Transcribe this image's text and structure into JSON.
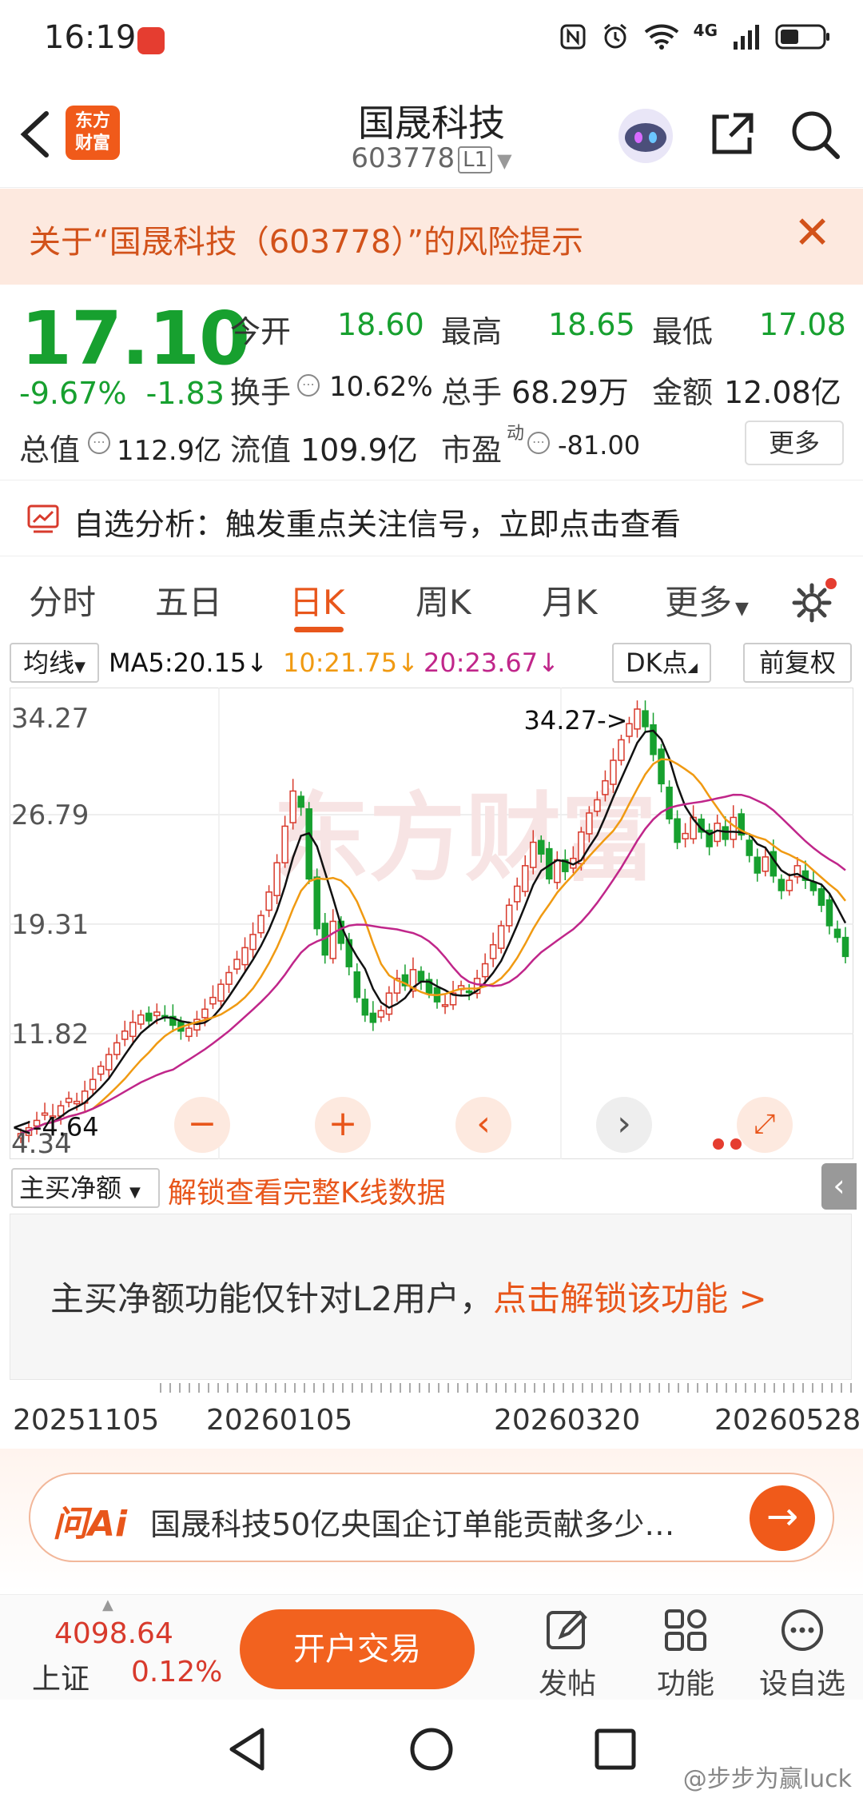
{
  "status_bar": {
    "time": "16:19",
    "network": "4G"
  },
  "header": {
    "logo_text_line1": "东方",
    "logo_text_line2": "财富",
    "title": "国晟科技",
    "code": "603778",
    "level": "L1"
  },
  "risk_banner": {
    "text": "关于“国晟科技（603778）”的风险提示"
  },
  "quote": {
    "price": "17.10",
    "change_pct": "-9.67%",
    "change": "-1.83",
    "open_label": "今开",
    "open": "18.60",
    "high_label": "最高",
    "high": "18.65",
    "low_label": "最低",
    "low": "17.08",
    "turnover_label": "换手",
    "turnover": "10.62%",
    "volume_label": "总手",
    "volume": "68.29万",
    "amount_label": "金额",
    "amount": "12.08亿",
    "mktcap_label": "总值",
    "mktcap": "112.9亿",
    "float_label": "流值",
    "float": "109.9亿",
    "pe_label": "市盈",
    "pe_sup": "动",
    "pe": "-81.00",
    "more": "更多"
  },
  "analysis": {
    "text": "自选分析：触发重点关注信号，立即点击查看"
  },
  "tabs": [
    "分时",
    "五日",
    "日K",
    "周K",
    "月K",
    "更多"
  ],
  "ma_row": {
    "type": "均线",
    "ma5": "MA5:20.15↓",
    "ma10": "10:21.75↓",
    "ma20": "20:23.67↓",
    "dk": "DK点",
    "adjust": "前复权"
  },
  "colors": {
    "accent": "#e8561b",
    "up": "#d83a2c",
    "down": "#17a02f",
    "ma5": "#111111",
    "ma10": "#f09a12",
    "ma20": "#c0268a"
  },
  "chart_data": {
    "type": "candlestick",
    "y_ticks": [
      "34.27",
      "26.79",
      "19.31",
      "11.82",
      "4.34"
    ],
    "ylim": [
      4.34,
      34.27
    ],
    "high_annotation": "34.27->",
    "low_annotation": "<-4.64",
    "x_ticks": [
      "20251105",
      "20260105",
      "20260320",
      "20260528"
    ],
    "ma5_last": 20.15,
    "ma10_last": 21.75,
    "ma20_last": 23.67,
    "closes": [
      5.0,
      5.4,
      5.9,
      6.4,
      6.2,
      6.9,
      7.4,
      7.2,
      7.9,
      8.7,
      9.6,
      10.4,
      11.2,
      12.0,
      12.6,
      13.1,
      12.7,
      13.3,
      13.0,
      12.4,
      12.0,
      12.2,
      12.8,
      13.5,
      14.3,
      15.2,
      16.0,
      16.9,
      17.7,
      18.6,
      19.9,
      21.5,
      23.5,
      26.0,
      28.4,
      27.3,
      22.4,
      19.0,
      17.2,
      19.5,
      18.0,
      16.4,
      14.3,
      13.1,
      12.6,
      13.4,
      14.6,
      15.6,
      15.1,
      16.2,
      15.4,
      14.6,
      14.0,
      13.8,
      14.6,
      15.1,
      14.7,
      15.6,
      16.6,
      17.9,
      19.2,
      20.6,
      21.9,
      23.3,
      24.9,
      24.1,
      22.4,
      23.7,
      22.9,
      23.8,
      25.6,
      26.9,
      27.8,
      29.1,
      30.5,
      31.9,
      33.0,
      34.0,
      32.8,
      30.9,
      28.9,
      26.5,
      24.9,
      25.5,
      26.6,
      25.6,
      24.6,
      26.2,
      25.1,
      26.6,
      25.4,
      24.0,
      22.8,
      23.9,
      22.6,
      21.6,
      22.3,
      23.3,
      22.3,
      21.6,
      20.6,
      19.2,
      18.4,
      17.1
    ]
  },
  "indicator": {
    "type": "主买净额",
    "unlock_link": "解锁查看完整K线数据",
    "message": "主买净额功能仅针对L2用户，",
    "message_link": "点击解锁该功能 >"
  },
  "ai_bar": {
    "logo": "问Ai",
    "text": "国晟科技50亿央国企订单能贡献多少…"
  },
  "toolbar": {
    "index_value": "4098.64",
    "index_name": "上证",
    "index_pct": "0.12%",
    "trade_button": "开户交易",
    "post": "发帖",
    "functions": "功能",
    "watchlist": "设自选"
  },
  "watermark": "@步步为赢luck"
}
